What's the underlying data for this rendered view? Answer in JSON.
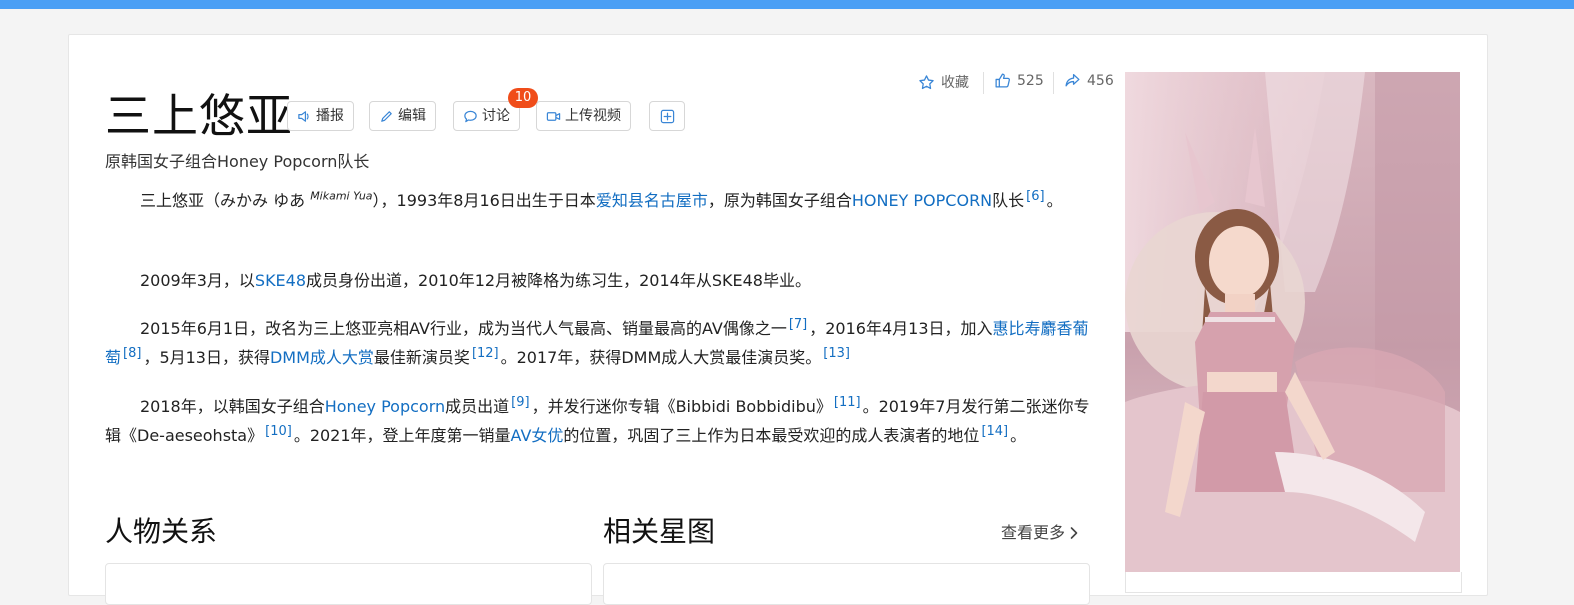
{
  "title": "三上悠亚",
  "subtitle": "原韩国女子组合Honey Popcorn队长",
  "toolbar": {
    "broadcast": "播报",
    "edit": "编辑",
    "discuss": "讨论",
    "discuss_badge": "10",
    "upload_video": "上传视频"
  },
  "actions": {
    "favorite": "收藏",
    "likes": "525",
    "shares": "456"
  },
  "paragraphs": {
    "p1": {
      "a": "三上悠亚（みかみ ゆあ",
      "romaji": "Mikami Yua",
      "b": "），1993年8月16日出生于日本",
      "link1": "爱知县名古屋市",
      "c": "，原为韩国女子组合",
      "link2": "HONEY POPCORN",
      "d": "队长",
      "ref1": "[6]",
      "e": "。"
    },
    "p2": {
      "a": "2009年3月，以",
      "link1": "SKE48",
      "b": "成员身份出道，2010年12月被降格为练习生，2014年从SKE48毕业。"
    },
    "p3": {
      "a": "2015年6月1日，改名为三上悠亚亮相AV行业，成为当代人气最高、销量最高的AV偶像之一",
      "ref1": "[7]",
      "b": "，2016年4月13日，加入",
      "link1": "惠比寿麝香葡萄",
      "ref2": "[8]",
      "c": "，5月13日，获得",
      "link2": "DMM成人大赏",
      "d": "最佳新演员奖",
      "ref3": "[12]",
      "e": "。2017年，获得DMM成人大赏最佳演员奖。",
      "ref4": "[13]"
    },
    "p4": {
      "a": "2018年，以韩国女子组合",
      "link1": "Honey Popcorn",
      "b": "成员出道",
      "ref1": "[9]",
      "c": "，并发行迷你专辑《Bibbidi Bobbidibu》",
      "ref2": "[11]",
      "d": "。2019年7月发行第二张迷你专辑《De-aeseohsta》",
      "ref3": "[10]",
      "e": "。2021年，登上年度第一销量",
      "link2": "AV女优",
      "f": "的位置，巩固了三上作为日本最受欢迎的成人表演者的地位",
      "ref4": "[14]",
      "g": "。"
    }
  },
  "sections": {
    "relations": "人物关系",
    "star_map": "相关星图",
    "more": "查看更多"
  },
  "colors": {
    "accent": "#4a9ff5",
    "link": "#136ec2",
    "badge": "#f04d1a",
    "icon": "#3a86d6"
  }
}
